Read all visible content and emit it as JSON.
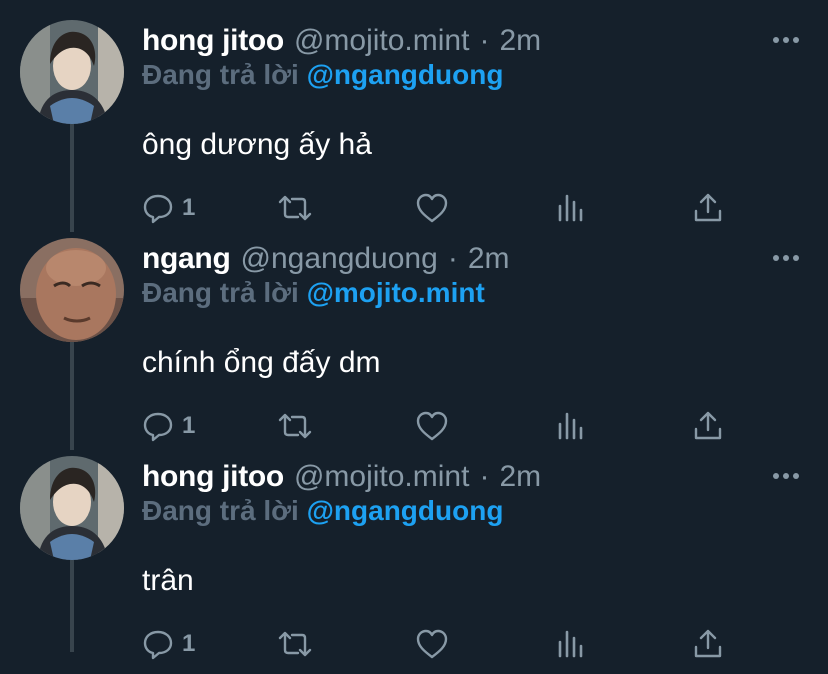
{
  "thread": {
    "tweets": [
      {
        "name": "hong jitoo",
        "handle": "@mojito.mint",
        "separator": "·",
        "time": "2m",
        "reply_prefix": "Đang trả lời",
        "reply_to": "@ngangduong",
        "text": "ông dương ấy hả",
        "reply_count": "1",
        "avatar_icon": "portrait-avatar"
      },
      {
        "name": "ngang",
        "handle": "@ngangduong",
        "separator": "·",
        "time": "2m",
        "reply_prefix": "Đang trả lời",
        "reply_to": "@mojito.mint",
        "text": "chính ổng đấy dm",
        "reply_count": "1",
        "avatar_icon": "portrait-avatar"
      },
      {
        "name": "hong jitoo",
        "handle": "@mojito.mint",
        "separator": "·",
        "time": "2m",
        "reply_prefix": "Đang trả lời",
        "reply_to": "@ngangduong",
        "text": "trân",
        "reply_count": "1",
        "avatar_icon": "portrait-avatar"
      }
    ]
  },
  "icons": [
    "reply-icon",
    "retweet-icon",
    "like-icon",
    "analytics-icon",
    "share-icon",
    "more-icon"
  ],
  "colors": {
    "background": "#15202b",
    "text": "#ffffff",
    "secondary_text": "#8899a6",
    "mention": "#1da1f2",
    "thread_line": "#38444d"
  }
}
